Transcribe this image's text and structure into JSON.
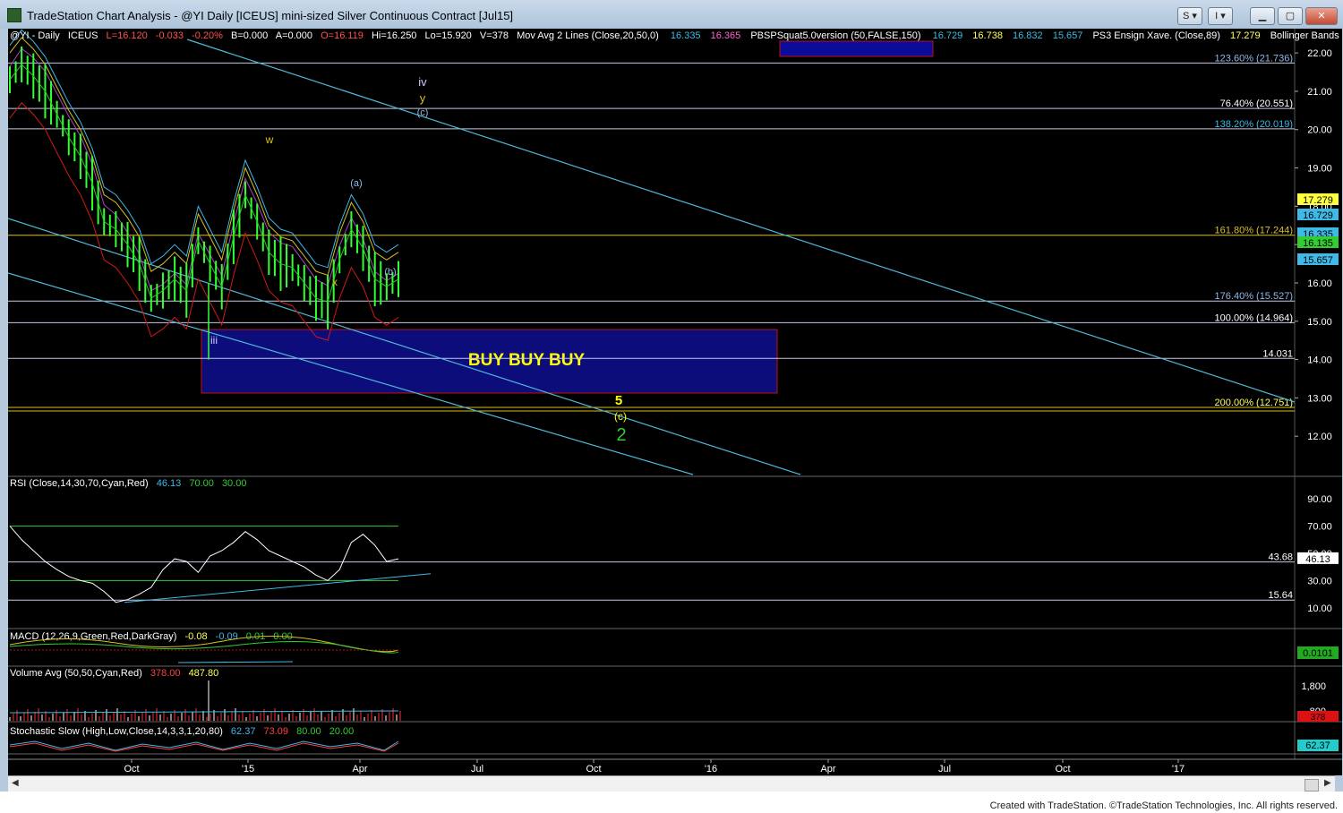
{
  "window": {
    "title": "TradeStation Chart Analysis - @YI Daily [ICEUS] mini-sized Silver Continuous Contract [Jul15]",
    "buttons": [
      "S",
      "I"
    ],
    "footer": "Created with TradeStation. ©TradeStation Technologies, Inc. All rights reserved."
  },
  "colors": {
    "background": "#000000",
    "price_bars": "#33ff33",
    "channel": "#4fb8d8",
    "bollinger": "#3fb9e6",
    "ma20": "#d8c020",
    "ma50": "#b040c0",
    "bb_lower": "#d01818",
    "buy_box": "#0c0c7a",
    "fib_line": "#c8c8e8"
  },
  "header": {
    "symbol": "@YI - Daily",
    "exchange": "ICEUS",
    "last": "L=16.120",
    "change": "-0.033",
    "change_pct": "-0.20%",
    "bid": "B=0.000",
    "ask": "A=0.000",
    "open": "O=16.119",
    "high": "Hi=16.250",
    "low": "Lo=15.920",
    "volume": "V=378",
    "ma_label": "Mov Avg 2 Lines (Close,20,50,0)",
    "ma_v1": "16.335",
    "ma_v2": "16.365",
    "pbs_label": "PBSPSquat5.0version (50,FALSE,150)",
    "pbs_v1": "16.729",
    "pbs_v2": "16.738",
    "pbs_v3": "16.832",
    "pbs_v4": "15.657",
    "ens_label": "PS3 Ensign Xave. (Close,89)",
    "ens_v": "17.279",
    "bb_label": "Bollinger Bands (Close,Ck"
  },
  "chart_data": [
    {
      "type": "line",
      "pane": "price",
      "yrange": [
        11.0,
        22.4
      ],
      "yticks": [
        "22.00",
        "21.00",
        "20.00",
        "19.00",
        "18.00",
        "17.00",
        "16.00",
        "15.00",
        "14.00",
        "13.00",
        "12.00"
      ],
      "x_labels": [
        "Oct",
        "'15",
        "Apr",
        "Jul",
        "Oct",
        "'16",
        "Apr",
        "Jul",
        "Oct",
        "'17"
      ],
      "fib_levels": [
        {
          "label": "123.60% (21.736)",
          "value": 21.736
        },
        {
          "label": "76.40% (20.551)",
          "value": 20.551
        },
        {
          "label": "138.20% (20.019)",
          "value": 20.019
        },
        {
          "label": "161.80% (17.244)",
          "value": 17.244
        },
        {
          "label": "176.40% (15.527)",
          "value": 15.527
        },
        {
          "label": "100.00% (14.964)",
          "value": 14.964
        },
        {
          "label": "14.031",
          "value": 14.031
        },
        {
          "label": "200.00% (12.751)",
          "value": 12.751
        }
      ],
      "price_badges": [
        {
          "label": "17.279",
          "color": "#ffff40"
        },
        {
          "label": "16.729",
          "color": "#3fb9e6"
        },
        {
          "label": "16.335",
          "color": "#3fb9e6"
        },
        {
          "label": "16.135",
          "color": "#33cc33"
        },
        {
          "label": "15.657",
          "color": "#3fb9e6"
        }
      ],
      "wave_labels": [
        "iv",
        "y",
        "(c)",
        "w",
        "(a)",
        "(b)",
        "x",
        "iii",
        "5",
        "(c)",
        "2"
      ],
      "buy_box_text": "BUY BUY BUY",
      "series": [
        {
          "name": "Close",
          "x": [
            0,
            6,
            12,
            18,
            24,
            30,
            36,
            42,
            48,
            54,
            60,
            66,
            72,
            78,
            84,
            90,
            96,
            102,
            108,
            114,
            120,
            126,
            132,
            138,
            144,
            150,
            156,
            162,
            168,
            174,
            180,
            186,
            192,
            198
          ],
          "values": [
            21.3,
            21.7,
            21.4,
            21.0,
            20.4,
            19.8,
            19.3,
            18.6,
            17.6,
            17.4,
            17.0,
            16.5,
            15.6,
            15.8,
            16.1,
            15.8,
            17.1,
            16.5,
            15.9,
            17.2,
            18.3,
            17.6,
            16.8,
            16.5,
            16.4,
            16.0,
            15.6,
            15.5,
            16.6,
            17.4,
            16.9,
            16.1,
            15.9,
            16.1
          ]
        }
      ]
    },
    {
      "type": "line",
      "pane": "rsi",
      "title": "RSI (Close,14,30,70,Cyan,Red)",
      "values_text": [
        "46.13",
        "70.00",
        "30.00"
      ],
      "yticks": [
        "90.00",
        "70.00",
        "50.00",
        "30.00",
        "10.00"
      ],
      "yrange": [
        0,
        100
      ],
      "levels": [
        {
          "label": "43.68",
          "value": 43.68
        },
        {
          "label": "15.64",
          "value": 15.64
        }
      ],
      "current": "46.13",
      "series": [
        {
          "name": "RSI",
          "values": [
            70,
            60,
            52,
            44,
            38,
            33,
            30,
            28,
            22,
            14,
            16,
            20,
            25,
            38,
            46,
            44,
            36,
            48,
            52,
            58,
            66,
            60,
            52,
            48,
            44,
            40,
            34,
            30,
            38,
            58,
            64,
            56,
            44,
            46
          ]
        }
      ]
    },
    {
      "type": "line",
      "pane": "macd",
      "title": "MACD (12,26,9,Green,Red,DarkGray)",
      "values_text": [
        "-0.08",
        "-0.09",
        "0.01",
        "0.00"
      ],
      "current": "0.0101"
    },
    {
      "type": "bar",
      "pane": "volume",
      "title": "Volume Avg (50,50,Cyan,Red)",
      "values_text": [
        "378.00",
        "487.80"
      ],
      "yticks": [
        "1,800",
        "800"
      ],
      "current": "378"
    },
    {
      "type": "line",
      "pane": "stochastic",
      "title": "Stochastic Slow (High,Low,Close,14,3,3,1,20,80)",
      "values_text": [
        "62.37",
        "73.09",
        "80.00",
        "20.00"
      ],
      "current": "62.37"
    }
  ]
}
